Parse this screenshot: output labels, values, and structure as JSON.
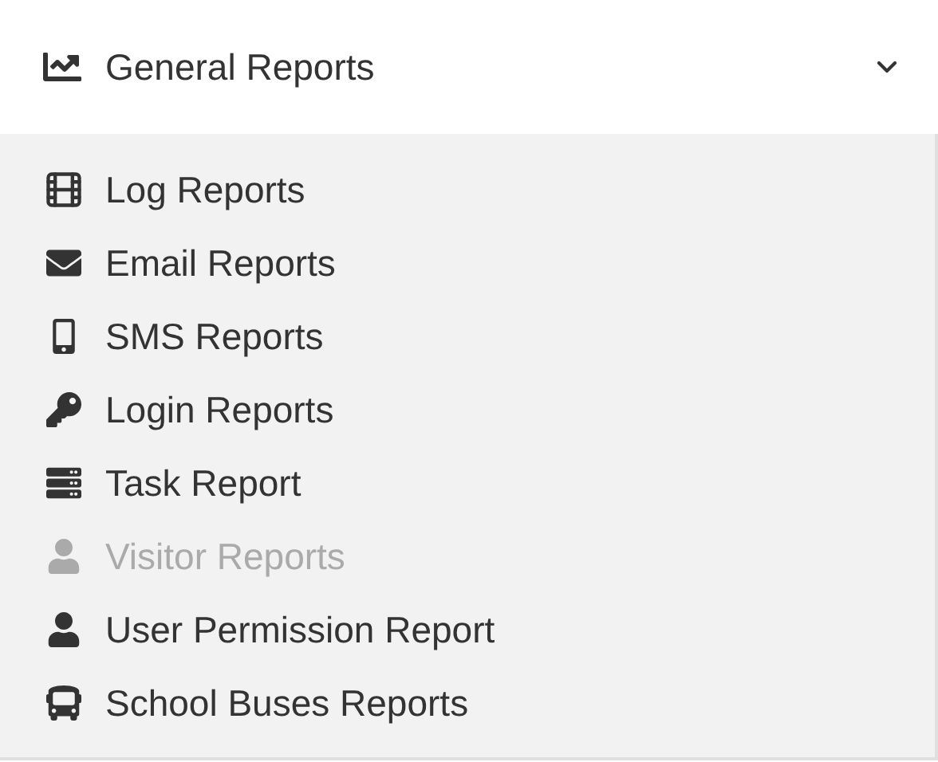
{
  "header": {
    "title": "General Reports",
    "expanded": true
  },
  "items": [
    {
      "label": "Log Reports",
      "disabled": false
    },
    {
      "label": "Email Reports",
      "disabled": false
    },
    {
      "label": "SMS Reports",
      "disabled": false
    },
    {
      "label": "Login Reports",
      "disabled": false
    },
    {
      "label": "Task Report",
      "disabled": false
    },
    {
      "label": "Visitor Reports",
      "disabled": true
    },
    {
      "label": "User Permission Report",
      "disabled": false
    },
    {
      "label": "School Buses Reports",
      "disabled": false
    }
  ]
}
